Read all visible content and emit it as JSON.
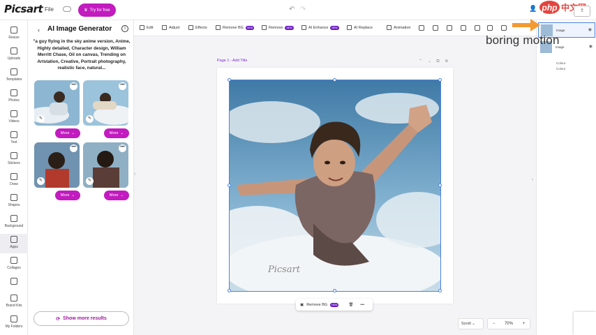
{
  "app": {
    "logo": "Picsart",
    "file_label": "File",
    "try_button": "Try for free",
    "php_badge": "php",
    "cn_label": "中文网"
  },
  "rail": [
    {
      "label": "Resize"
    },
    {
      "label": "Uploads"
    },
    {
      "label": "Templates"
    },
    {
      "label": "Photos"
    },
    {
      "label": "Videos"
    },
    {
      "label": "Text"
    },
    {
      "label": "Stickers"
    },
    {
      "label": "Draw"
    },
    {
      "label": "Shapes"
    },
    {
      "label": "Background"
    },
    {
      "label": "Apps"
    },
    {
      "label": "Collages"
    },
    {
      "label": ""
    },
    {
      "label": "Brand Kits"
    },
    {
      "label": "My Folders"
    }
  ],
  "panel": {
    "title": "AI Image Generator",
    "prompt": "\"a guy flying in the sky anime version, Anime, Highly detailed, Character design, William Merritt Chase, Oil on canvas, Trending on Artstation, Creative, Portrait photography, realistic face, natural...",
    "more_label": "More",
    "show_more": "Show more results"
  },
  "toolbar": {
    "edit": "Edit",
    "adjust": "Adjust",
    "effects": "Effects",
    "remove_bg": "Remove BG",
    "remove": "Remove",
    "ai_enhance": "AI Enhance",
    "ai_replace": "AI Replace",
    "animation": "Animation",
    "new_badge": "NEW"
  },
  "canvas": {
    "page_label": "Page 1 - Add Title",
    "watermark": "Picsart"
  },
  "float_bar": {
    "remove_bg": "Remove BG",
    "new_badge": "NEW"
  },
  "layers": {
    "items": [
      {
        "name": "Image"
      },
      {
        "name": "Image"
      }
    ],
    "bg_items": [
      "Colour",
      "Colour"
    ]
  },
  "overlay": {
    "boring_motion": "boring motion"
  },
  "zoom": {
    "scroll_label": "Scroll",
    "value": "70%"
  },
  "colors": {
    "brand": "#c21bbf",
    "selection": "#4a82e0",
    "badge": "#6a1bc2"
  }
}
